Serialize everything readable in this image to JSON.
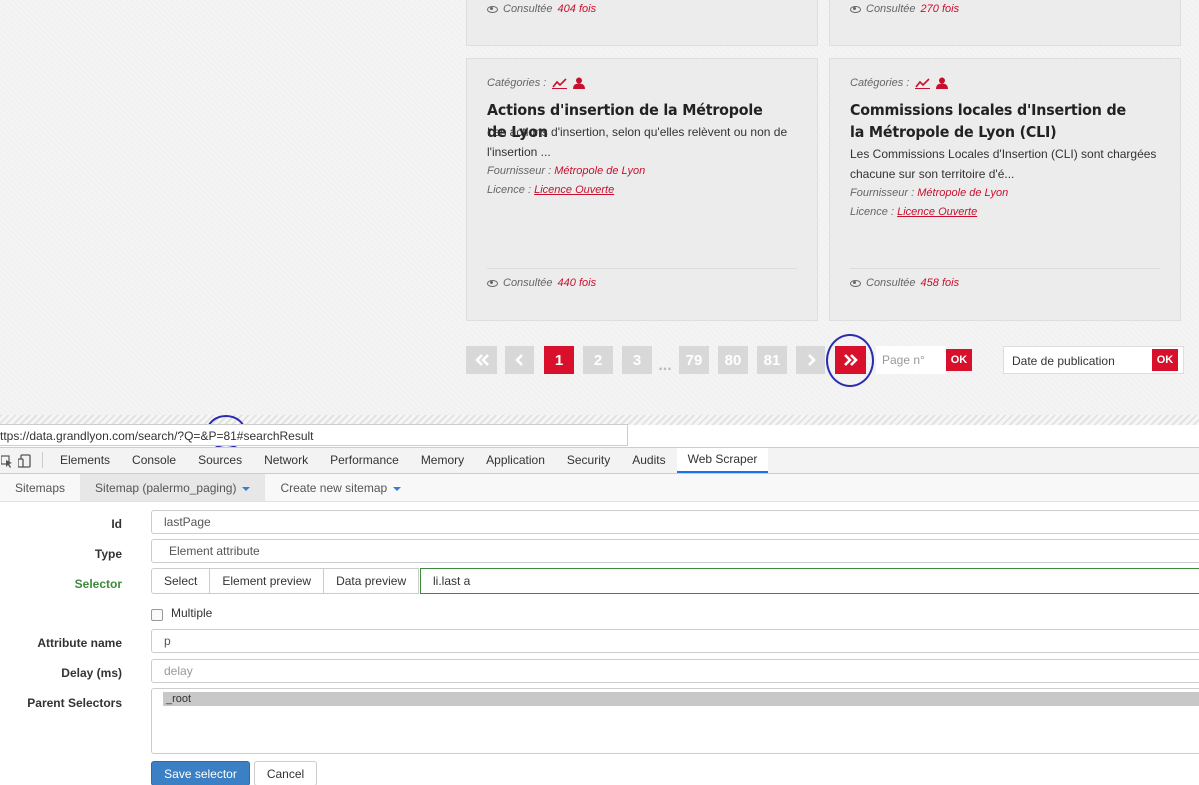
{
  "site": {
    "top_cards": [
      {
        "views_prefix": "Consultée",
        "views_num": "404 fois"
      },
      {
        "views_prefix": "Consultée",
        "views_num": "270 fois"
      }
    ],
    "cards": [
      {
        "categories_label": "Catégories :",
        "title": "Actions d'insertion de la Métropole de Lyon",
        "description": "Les actions d'insertion, selon qu'elles relèvent ou non de l'insertion ...",
        "provider_label": "Fournisseur :",
        "provider": "Métropole de Lyon",
        "license_label": "Licence :",
        "license": "Licence Ouverte",
        "views_prefix": "Consultée",
        "views_num": "440 fois"
      },
      {
        "categories_label": "Catégories :",
        "title": "Commissions locales d'Insertion de la Métropole de Lyon (CLI)",
        "description": "Les Commissions Locales d'Insertion (CLI) sont chargées chacune sur son territoire d'é...",
        "provider_label": "Fournisseur :",
        "provider": "Métropole de Lyon",
        "license_label": "Licence :",
        "license": "Licence Ouverte",
        "views_prefix": "Consultée",
        "views_num": "458 fois"
      }
    ],
    "pagination": {
      "first": "«",
      "prev": "‹",
      "pages": [
        "1",
        "2",
        "3"
      ],
      "ellipsis": "...",
      "tail_pages": [
        "79",
        "80",
        "81"
      ],
      "next": "›",
      "last": "»",
      "active_page": "1",
      "page_input_placeholder": "Page n°",
      "ok_label": "OK",
      "sort_label": "Date de publication",
      "sort_ok": "OK"
    }
  },
  "urlbar": {
    "text": "ttps://data.grandlyon.com/search/?Q=&P=81#searchResult"
  },
  "devtools": {
    "tabs": [
      "Elements",
      "Console",
      "Sources",
      "Network",
      "Performance",
      "Memory",
      "Application",
      "Security",
      "Audits",
      "Web Scraper"
    ],
    "active_tab": "Web Scraper"
  },
  "webscraper": {
    "nav": {
      "sitemaps": "Sitemaps",
      "sitemap": "Sitemap (palermo_paging)",
      "create": "Create new sitemap"
    },
    "form": {
      "id_label": "Id",
      "id_value": "lastPage",
      "type_label": "Type",
      "type_value": "Element attribute",
      "selector_label": "Selector",
      "select_btn": "Select",
      "element_preview_btn": "Element preview",
      "data_preview_btn": "Data preview",
      "selector_value": "li.last a",
      "multiple_label": "Multiple",
      "attribute_label": "Attribute name",
      "attribute_value": "p",
      "delay_label": "Delay (ms)",
      "delay_placeholder": "delay",
      "parent_label": "Parent Selectors",
      "parent_option": "_root",
      "save_btn": "Save selector",
      "cancel_btn": "Cancel"
    }
  },
  "colors": {
    "accent_red": "#d8102b",
    "annotation_blue": "#2c2cb0",
    "selector_green": "#3c8a3c"
  }
}
